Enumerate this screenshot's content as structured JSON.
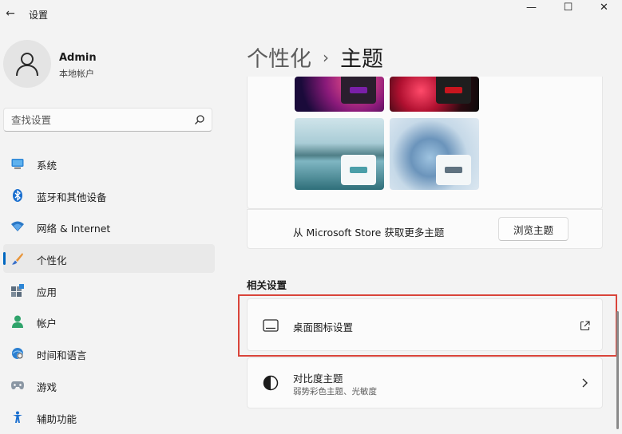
{
  "window": {
    "title": "设置",
    "back_glyph": "←",
    "minimize_glyph": "—",
    "maximize_glyph": "☐",
    "close_glyph": "✕"
  },
  "profile": {
    "name": "Admin",
    "account_type": "本地帐户"
  },
  "search": {
    "placeholder": "查找设置",
    "value": ""
  },
  "sidebar": {
    "items": [
      {
        "label": "系统",
        "icon": "monitor-icon",
        "selected": false
      },
      {
        "label": "蓝牙和其他设备",
        "icon": "bluetooth-icon",
        "selected": false
      },
      {
        "label": "网络 & Internet",
        "icon": "wifi-icon",
        "selected": false
      },
      {
        "label": "个性化",
        "icon": "brush-icon",
        "selected": true
      },
      {
        "label": "应用",
        "icon": "apps-icon",
        "selected": false
      },
      {
        "label": "帐户",
        "icon": "person-icon",
        "selected": false
      },
      {
        "label": "时间和语言",
        "icon": "globe-clock-icon",
        "selected": false
      },
      {
        "label": "游戏",
        "icon": "gamepad-icon",
        "selected": false
      },
      {
        "label": "辅助功能",
        "icon": "accessibility-icon",
        "selected": false
      }
    ]
  },
  "breadcrumb": {
    "parent": "个性化",
    "separator": "›",
    "current": "主题"
  },
  "store": {
    "text": "从 Microsoft Store 获取更多主题",
    "button_label": "浏览主题"
  },
  "related": {
    "title": "相关设置",
    "desktop_icons": {
      "title": "桌面图标设置",
      "icon": "desktop-icon",
      "action_icon": "external-link-icon"
    },
    "contrast": {
      "title": "对比度主题",
      "subtitle": "弱势彩色主题、光敏度",
      "icon": "contrast-icon",
      "action_icon": "chevron-right-icon"
    }
  },
  "colors": {
    "accent": "#0067c0",
    "highlight_border": "#d9443a",
    "chip_purple": "#7a1fa8",
    "chip_red": "#c8151e",
    "chip_teal": "#4a9ea8",
    "chip_slate": "#5f7280"
  }
}
